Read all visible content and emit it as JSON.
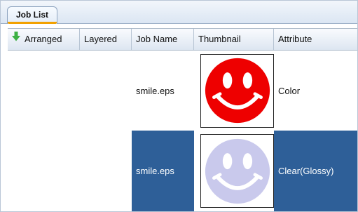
{
  "tabs": [
    {
      "label": "Job List",
      "active": true
    }
  ],
  "columns": [
    {
      "key": "arranged",
      "label": "Arranged",
      "sort_icon": "green-down-arrow-icon"
    },
    {
      "key": "layered",
      "label": "Layered"
    },
    {
      "key": "job_name",
      "label": "Job Name"
    },
    {
      "key": "thumbnail",
      "label": "Thumbnail"
    },
    {
      "key": "attribute",
      "label": "Attribute"
    }
  ],
  "rows": [
    {
      "arranged": "",
      "layered": "",
      "job_name": "smile.eps",
      "thumbnail": "smiley-face-icon",
      "thumbnail_color": "#ee0000",
      "attribute": "Color",
      "selected": false
    },
    {
      "arranged": "",
      "layered": "",
      "job_name": "smile.eps",
      "thumbnail": "smiley-face-icon",
      "thumbnail_color": "#c9c9ec",
      "attribute": "Clear(Glossy)",
      "selected": true
    }
  ],
  "colors": {
    "selection": "#2e5f98",
    "tab_accent": "#f2a100",
    "sort_arrow": "#3cb043"
  }
}
